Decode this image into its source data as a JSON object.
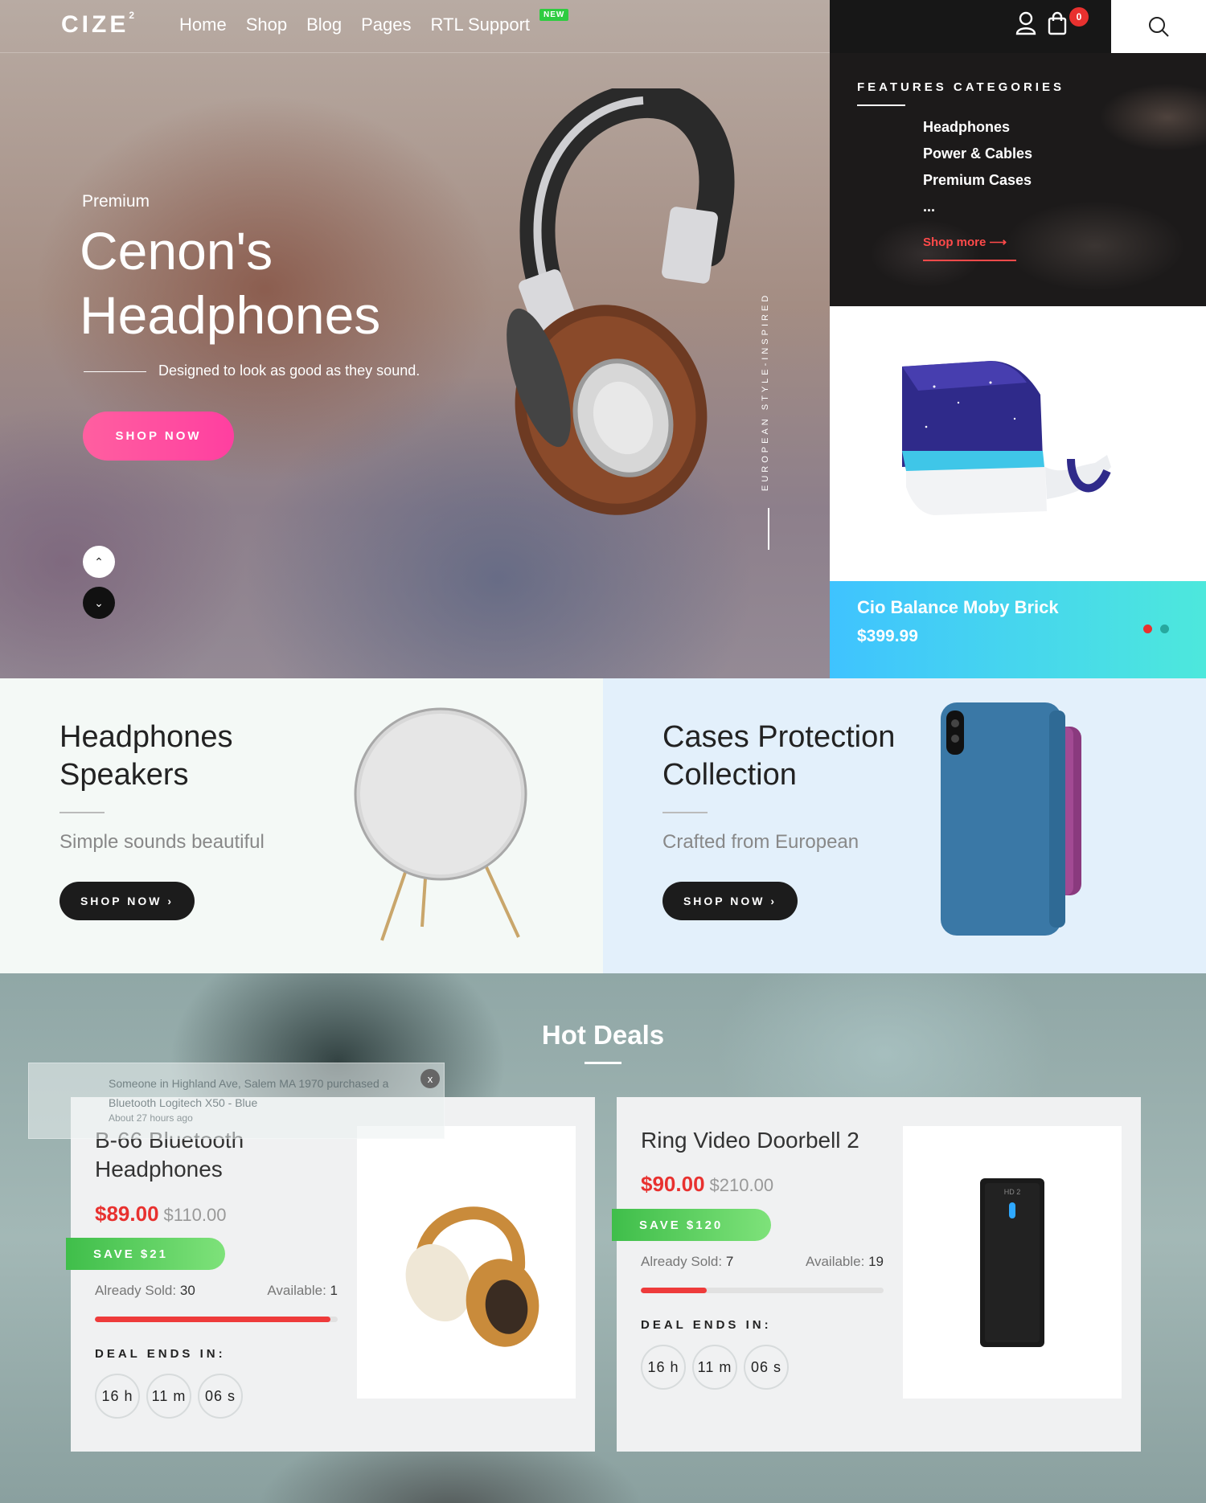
{
  "header": {
    "logo": "CIZE",
    "logo_sup": "2",
    "nav": [
      "Home",
      "Shop",
      "Blog",
      "Pages",
      "RTL Support"
    ],
    "new_badge": "NEW",
    "cart_count": "0"
  },
  "hero": {
    "subtitle": "Premium",
    "title_line1": "Cenon's",
    "title_line2": "Headphones",
    "tagline": "Designed to look as good as they sound.",
    "cta": "SHOP NOW",
    "vertical_text": "EUROPEAN STYLE-INSPIRED",
    "arrow_up": "⌃",
    "arrow_down": "⌄"
  },
  "features": {
    "title": "FEATURES CATEGORIES",
    "items": [
      "Headphones",
      "Power & Cables",
      "Premium Cases",
      "..."
    ],
    "shop_more": "Shop more"
  },
  "featured_product": {
    "name": "Cio Balance Moby Brick",
    "price": "$399.99"
  },
  "banners": [
    {
      "title": "Headphones Speakers",
      "subtitle": "Simple sounds beautiful",
      "cta": "SHOP NOW ›"
    },
    {
      "title": "Cases Protection Collection",
      "subtitle": "Crafted from European",
      "cta": "SHOP NOW ›"
    }
  ],
  "hot_deals": {
    "title": "Hot Deals",
    "ends_label": "DEAL ENDS IN:",
    "cards": [
      {
        "name": "B-66 Bluetooth Headphones",
        "price": "$89.00",
        "old_price": "$110.00",
        "save": "SAVE $21",
        "sold_label": "Already Sold:",
        "sold": "30",
        "avail_label": "Available:",
        "avail": "1",
        "progress": 0.97,
        "h": "16 h",
        "m": "11 m",
        "s": "06 s"
      },
      {
        "name": "Ring Video Doorbell 2",
        "price": "$90.00",
        "old_price": "$210.00",
        "save": "SAVE $120",
        "sold_label": "Already Sold:",
        "sold": "7",
        "avail_label": "Available:",
        "avail": "19",
        "progress": 0.27,
        "h": "16 h",
        "m": "11 m",
        "s": "06 s"
      }
    ]
  },
  "notification": {
    "text": "Someone in Highland Ave, Salem MA 1970 purchased a Bluetooth Logitech X50 - Blue",
    "time": "About 27 hours ago",
    "close": "x"
  },
  "colors": {
    "accent_red": "#e8312f",
    "accent_pink": "#ff4fa0",
    "save_green": "#3fbe4a",
    "moby_gradient_start": "#3fc3ff"
  }
}
